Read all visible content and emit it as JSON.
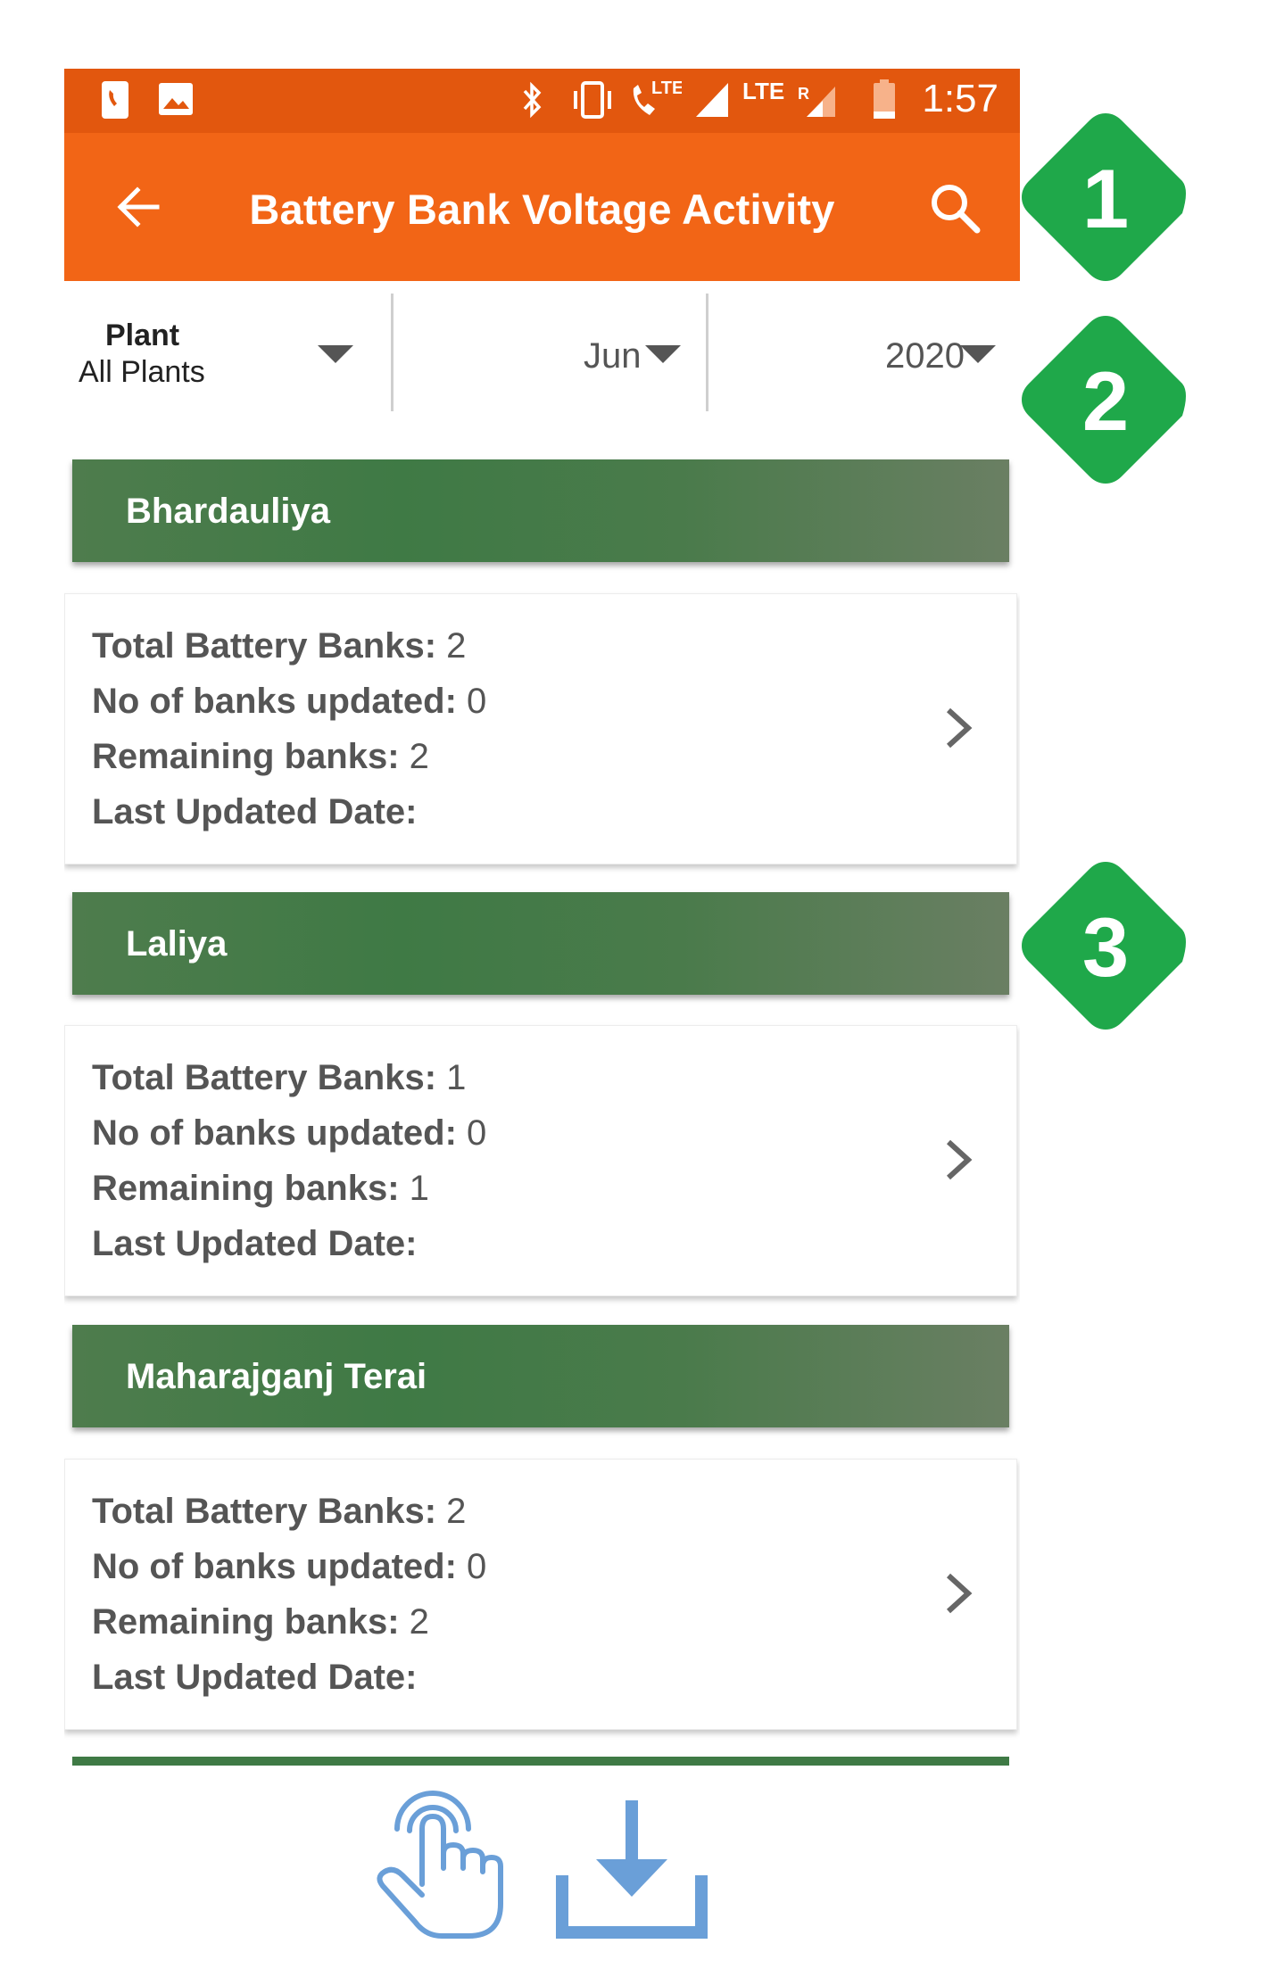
{
  "status_bar": {
    "time": "1:57",
    "icons": [
      "call-notification-icon",
      "image-notification-icon",
      "bluetooth-icon",
      "vibrate-icon",
      "volte-call-icon",
      "signal-icon",
      "lte-roaming-signal-icon",
      "battery-low-icon"
    ],
    "network_label_1": "LTE",
    "network_label_2": "LTE",
    "roaming_label": "R",
    "color": "#e2570e"
  },
  "app_bar": {
    "title": "Battery Bank Voltage Activity",
    "back_icon": "arrow-back-icon",
    "search_icon": "search-icon",
    "color": "#f26516"
  },
  "filters": {
    "plant_label": "Plant",
    "plant_value": "All Plants",
    "month_value": "Jun",
    "year_value": "2020"
  },
  "plants": [
    {
      "name": "Bhardauliya",
      "total_label": "Total Battery Banks:",
      "total_value": "2",
      "updated_label": "No of banks updated:",
      "updated_value": "0",
      "remaining_label": "Remaining banks:",
      "remaining_value": "2",
      "last_label": "Last Updated Date:",
      "last_value": ""
    },
    {
      "name": "Laliya",
      "total_label": "Total Battery Banks:",
      "total_value": "1",
      "updated_label": "No of banks updated:",
      "updated_value": "0",
      "remaining_label": "Remaining banks:",
      "remaining_value": "1",
      "last_label": "Last Updated Date:",
      "last_value": ""
    },
    {
      "name": "Maharajganj Terai",
      "total_label": "Total Battery Banks:",
      "total_value": "2",
      "updated_label": "No of banks updated:",
      "updated_value": "0",
      "remaining_label": "Remaining banks:",
      "remaining_value": "2",
      "last_label": "Last Updated Date:",
      "last_value": ""
    }
  ],
  "markers": [
    "1",
    "2",
    "3"
  ],
  "marker_color": "#1fa84a",
  "header_color": "#3f7a45",
  "bottom_icons": [
    "tap-hand-icon",
    "download-icon"
  ],
  "bottom_icon_color": "#6a9fd8"
}
